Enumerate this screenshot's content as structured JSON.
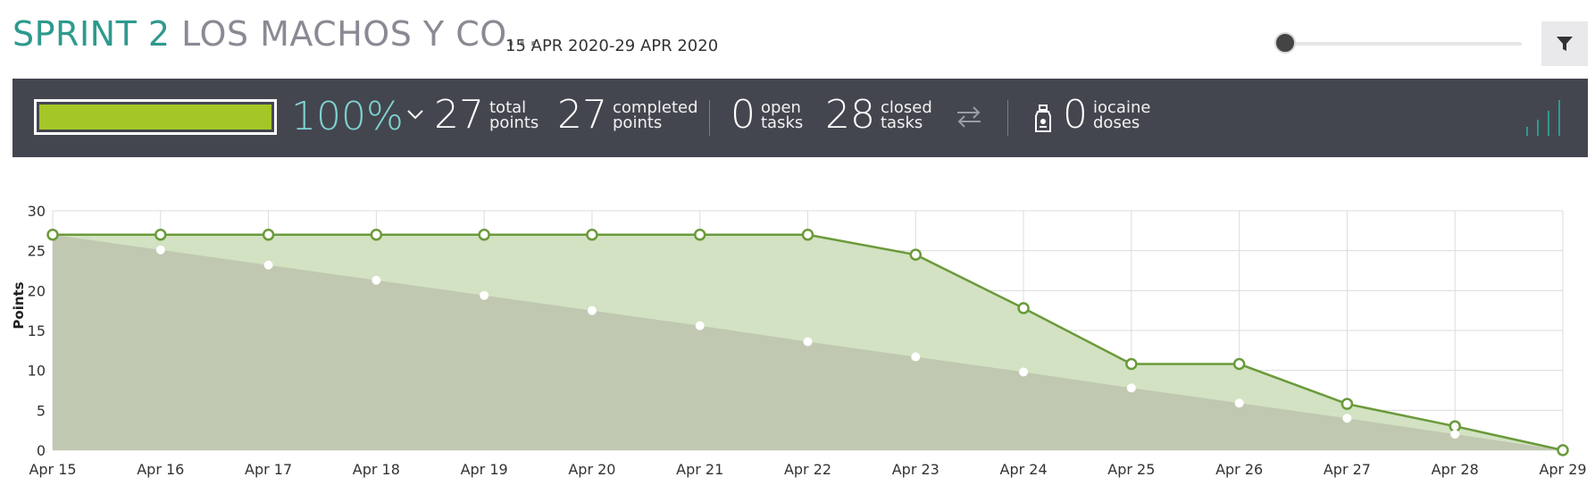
{
  "header": {
    "sprint_number": "SPRINT 2",
    "sprint_name": "LOS MACHOS Y CO...",
    "dates": "15 APR 2020-29 APR 2020",
    "filter_icon": "filter-icon"
  },
  "summary": {
    "progress_percent": "100%",
    "progress_fraction": 1.0,
    "progress_color": "#a4c727",
    "total_points": "27",
    "total_points_label_1": "total",
    "total_points_label_2": "points",
    "completed_points": "27",
    "completed_points_label_1": "completed",
    "completed_points_label_2": "points",
    "open_tasks": "0",
    "open_tasks_label_1": "open",
    "open_tasks_label_2": "tasks",
    "closed_tasks": "28",
    "closed_tasks_label_1": "closed",
    "closed_tasks_label_2": "tasks",
    "iocaine_doses": "0",
    "iocaine_label_1": "iocaine",
    "iocaine_label_2": "doses"
  },
  "chart_data": {
    "type": "area",
    "title": "",
    "xlabel": "",
    "ylabel": "Points",
    "categories": [
      "Apr 15",
      "Apr 16",
      "Apr 17",
      "Apr 18",
      "Apr 19",
      "Apr 20",
      "Apr 21",
      "Apr 22",
      "Apr 23",
      "Apr 24",
      "Apr 25",
      "Apr 26",
      "Apr 27",
      "Apr 28",
      "Apr 29"
    ],
    "yticks": [
      0,
      5,
      10,
      15,
      20,
      25,
      30
    ],
    "ylim": [
      0,
      30
    ],
    "grid": true,
    "legend": "none",
    "series": [
      {
        "color": "#6a9a3a",
        "fill": "#d0e0bf",
        "values": [
          27,
          27,
          27,
          27,
          27,
          27,
          27,
          27,
          24.5,
          17.8,
          10.8,
          10.8,
          5.8,
          3.0,
          0
        ]
      },
      {
        "color": "#ffffff",
        "fill": "#bfc6b0",
        "values": [
          27,
          25.1,
          23.2,
          21.3,
          19.4,
          17.5,
          15.6,
          13.6,
          11.7,
          9.8,
          7.8,
          5.9,
          4.0,
          2.0,
          0
        ]
      }
    ]
  }
}
